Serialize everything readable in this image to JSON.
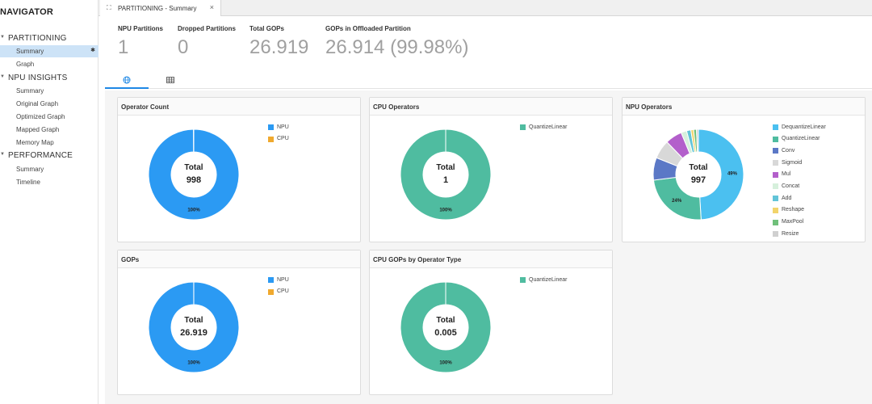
{
  "navigator": {
    "title": "NAVIGATOR",
    "sections": [
      {
        "label": "PARTITIONING",
        "items": [
          {
            "label": "Summary",
            "active": true
          },
          {
            "label": "Graph"
          }
        ]
      },
      {
        "label": "NPU INSIGHTS",
        "items": [
          {
            "label": "Summary"
          },
          {
            "label": "Original Graph"
          },
          {
            "label": "Optimized Graph"
          },
          {
            "label": "Mapped Graph"
          },
          {
            "label": "Memory Map"
          }
        ]
      },
      {
        "label": "PERFORMANCE",
        "items": [
          {
            "label": "Summary"
          },
          {
            "label": "Timeline"
          }
        ]
      }
    ]
  },
  "tab": {
    "label": "PARTITIONING - Summary",
    "close": "×"
  },
  "stats": [
    {
      "label": "NPU Partitions",
      "value": "1"
    },
    {
      "label": "Dropped Partitions",
      "value": "0"
    },
    {
      "label": "Total GOPs",
      "value": "26.919"
    },
    {
      "label": "GOPs in Offloaded Partition",
      "value": "26.914 (99.98%)"
    }
  ],
  "colors": {
    "npu": "#2b9af3",
    "cpu": "#f0a92e",
    "quantize": "#4fbca0",
    "accent": "#1e88e5"
  },
  "cards": [
    {
      "title": "Operator Count",
      "center_label": "Total",
      "center_value": "998",
      "legend": [
        {
          "name": "NPU",
          "color": "#2b9af3"
        },
        {
          "name": "CPU",
          "color": "#f0a92e"
        }
      ],
      "chart_data": {
        "type": "pie",
        "categories": [
          "NPU",
          "CPU"
        ],
        "values": [
          997,
          1
        ],
        "labels": [
          "100%"
        ]
      }
    },
    {
      "title": "CPU Operators",
      "center_label": "Total",
      "center_value": "1",
      "legend": [
        {
          "name": "QuantizeLinear",
          "color": "#4fbca0"
        }
      ],
      "chart_data": {
        "type": "pie",
        "categories": [
          "QuantizeLinear"
        ],
        "values": [
          1
        ],
        "labels": [
          "100%"
        ]
      }
    },
    {
      "title": "NPU Operators",
      "center_label": "Total",
      "center_value": "997",
      "legend": [
        {
          "name": "DequantizeLinear",
          "color": "#4bc0f0"
        },
        {
          "name": "QuantizeLinear",
          "color": "#4fbca0"
        },
        {
          "name": "Conv",
          "color": "#5b78c6"
        },
        {
          "name": "Sigmoid",
          "color": "#d8d8d8"
        },
        {
          "name": "Mul",
          "color": "#b35fcb"
        },
        {
          "name": "Concat",
          "color": "#d6f0dc"
        },
        {
          "name": "Add",
          "color": "#62c4d8"
        },
        {
          "name": "Reshape",
          "color": "#f2d46b"
        },
        {
          "name": "MaxPool",
          "color": "#70c07a"
        },
        {
          "name": "Resize",
          "color": "#d0d0d0"
        }
      ],
      "chart_data": {
        "type": "pie",
        "categories": [
          "DequantizeLinear",
          "QuantizeLinear",
          "Conv",
          "Sigmoid",
          "Mul",
          "Concat",
          "Add",
          "Reshape",
          "MaxPool",
          "Resize"
        ],
        "values": [
          489,
          239,
          80,
          67,
          60,
          20,
          15,
          10,
          10,
          7
        ],
        "labels": [
          "49%",
          "24%"
        ]
      }
    },
    {
      "title": "GOPs",
      "center_label": "Total",
      "center_value": "26.919",
      "legend": [
        {
          "name": "NPU",
          "color": "#2b9af3"
        },
        {
          "name": "CPU",
          "color": "#f0a92e"
        }
      ],
      "chart_data": {
        "type": "pie",
        "categories": [
          "NPU",
          "CPU"
        ],
        "values": [
          26.914,
          0.005
        ],
        "labels": [
          "100%"
        ]
      }
    },
    {
      "title": "CPU GOPs by Operator Type",
      "center_label": "Total",
      "center_value": "0.005",
      "legend": [
        {
          "name": "QuantizeLinear",
          "color": "#4fbca0"
        }
      ],
      "chart_data": {
        "type": "pie",
        "categories": [
          "QuantizeLinear"
        ],
        "values": [
          0.005
        ],
        "labels": [
          "100%"
        ]
      }
    }
  ]
}
